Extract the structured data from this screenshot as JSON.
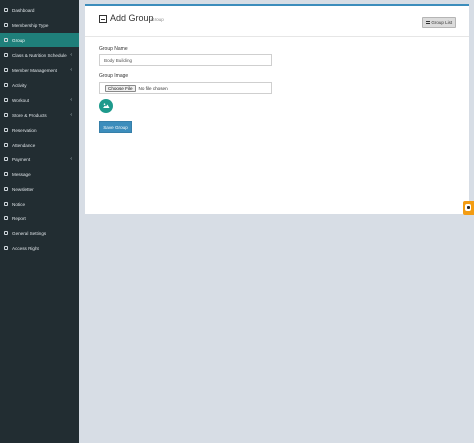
{
  "sidebar": {
    "items": [
      {
        "label": "Dashboard",
        "icon": "dashboard-icon",
        "chevron": false
      },
      {
        "label": "Membership Type",
        "icon": "membership-icon",
        "chevron": false
      },
      {
        "label": "Group",
        "icon": "group-icon",
        "chevron": false,
        "active": true
      },
      {
        "label": "Class & Nutrition Schedule",
        "icon": "calendar-icon",
        "chevron": true
      },
      {
        "label": "Member Management",
        "icon": "member-icon",
        "chevron": true
      },
      {
        "label": "Activity",
        "icon": "activity-icon",
        "chevron": false
      },
      {
        "label": "Workout",
        "icon": "workout-icon",
        "chevron": true
      },
      {
        "label": "Store & Products",
        "icon": "store-icon",
        "chevron": true
      },
      {
        "label": "Reservation",
        "icon": "reservation-icon",
        "chevron": false
      },
      {
        "label": "Attendance",
        "icon": "attendance-icon",
        "chevron": false
      },
      {
        "label": "Payment",
        "icon": "payment-icon",
        "chevron": true
      },
      {
        "label": "Message",
        "icon": "message-icon",
        "chevron": false
      },
      {
        "label": "Newsletter",
        "icon": "newsletter-icon",
        "chevron": false
      },
      {
        "label": "Notice",
        "icon": "notice-icon",
        "chevron": false
      },
      {
        "label": "Report",
        "icon": "report-icon",
        "chevron": false
      },
      {
        "label": "General Settings",
        "icon": "settings-icon",
        "chevron": false
      },
      {
        "label": "Access Right",
        "icon": "access-icon",
        "chevron": false
      }
    ],
    "chevron_glyph": "‹"
  },
  "header": {
    "title": "Add Group",
    "subtitle": "Group",
    "list_button_label": "Group List"
  },
  "form": {
    "group_name_label": "Group Name",
    "group_name_value": "Body Building",
    "group_image_label": "Group Image",
    "choose_file_label": "Choose File",
    "file_status": "No file chosen",
    "save_label": "Save Group"
  },
  "colors": {
    "sidebar_bg": "#222d32",
    "active_item": "#1f7f7a",
    "accent": "#3c8dbc",
    "preview": "#1e9a8c",
    "badge": "#f39c12"
  }
}
